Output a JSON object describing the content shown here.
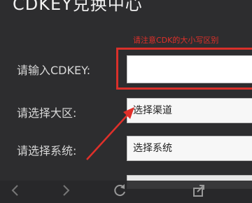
{
  "page": {
    "title": "CDKEY兑换中心",
    "hint": "请注意CDK的大小写区别"
  },
  "form": {
    "cdkey_label": "请输入CDKEY:",
    "cdkey_value": "",
    "region_label": "请选择大区:",
    "region_selected": "选择渠道",
    "system_label": "请选择系统:",
    "system_selected": "选择系统"
  },
  "colors": {
    "background": "#2d2d2f",
    "highlight": "#d9302a"
  },
  "icons": [
    "back-icon",
    "forward-icon",
    "refresh-icon",
    "share-icon"
  ]
}
